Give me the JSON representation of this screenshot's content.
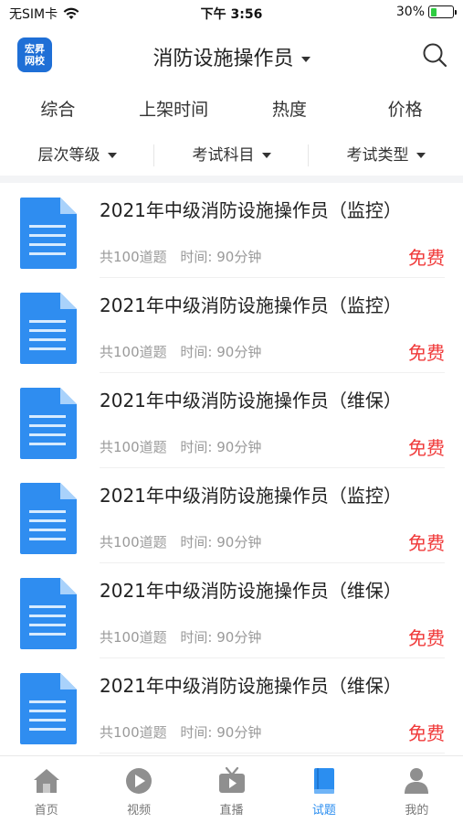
{
  "status_bar": {
    "carrier": "无SIM卡",
    "time": "下午 3:56",
    "battery": "30%",
    "battery_level": 0.3
  },
  "header": {
    "logo_line1": "宏昇",
    "logo_line2": "网校",
    "title": "消防设施操作员"
  },
  "sort_tabs": [
    "综合",
    "上架时间",
    "热度",
    "价格"
  ],
  "filters": [
    "层次等级",
    "考试科目",
    "考试类型"
  ],
  "items": [
    {
      "title": "2021年中级消防设施操作员（监控）",
      "count": "共100道题",
      "time": "时间: 90分钟",
      "price": "免费"
    },
    {
      "title": "2021年中级消防设施操作员（监控）",
      "count": "共100道题",
      "time": "时间: 90分钟",
      "price": "免费"
    },
    {
      "title": "2021年中级消防设施操作员（维保）",
      "count": "共100道题",
      "time": "时间: 90分钟",
      "price": "免费"
    },
    {
      "title": "2021年中级消防设施操作员（监控）",
      "count": "共100道题",
      "time": "时间: 90分钟",
      "price": "免费"
    },
    {
      "title": "2021年中级消防设施操作员（维保）",
      "count": "共100道题",
      "time": "时间: 90分钟",
      "price": "免费"
    },
    {
      "title": "2021年中级消防设施操作员（维保）",
      "count": "共100道题",
      "time": "时间: 90分钟",
      "price": "免费"
    }
  ],
  "tabbar": {
    "items": [
      {
        "label": "首页",
        "icon": "home-icon"
      },
      {
        "label": "视频",
        "icon": "video-icon"
      },
      {
        "label": "直播",
        "icon": "live-tv-icon"
      },
      {
        "label": "试题",
        "icon": "book-icon"
      },
      {
        "label": "我的",
        "icon": "user-icon"
      }
    ],
    "active_index": 3
  },
  "colors": {
    "accent": "#2b8ef0",
    "price": "#f03a3a",
    "logo": "#1f6fd6",
    "doc_icon": "#2f8df0"
  }
}
